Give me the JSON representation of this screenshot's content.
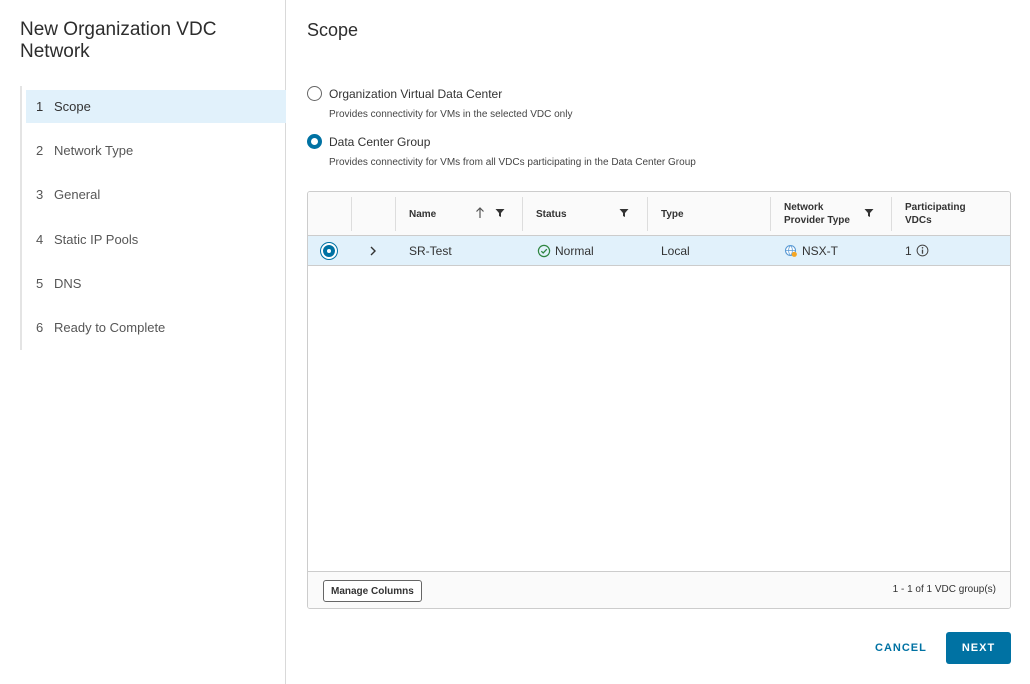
{
  "wizard": {
    "title": "New Organization VDC Network",
    "steps": [
      {
        "num": "1",
        "label": "Scope",
        "active": true
      },
      {
        "num": "2",
        "label": "Network Type"
      },
      {
        "num": "3",
        "label": "General"
      },
      {
        "num": "4",
        "label": "Static IP Pools"
      },
      {
        "num": "5",
        "label": "DNS"
      },
      {
        "num": "6",
        "label": "Ready to Complete"
      }
    ]
  },
  "main": {
    "title": "Scope",
    "options": [
      {
        "label": "Organization Virtual Data Center",
        "desc": "Provides connectivity for VMs in the selected VDC only",
        "selected": false
      },
      {
        "label": "Data Center Group",
        "desc": "Provides connectivity for VMs from all VDCs participating in the Data Center Group",
        "selected": true
      }
    ]
  },
  "grid": {
    "columns": {
      "name": "Name",
      "status": "Status",
      "type": "Type",
      "provider_line1": "Network",
      "provider_line2": "Provider Type",
      "participating_line1": "Participating",
      "participating_line2": "VDCs"
    },
    "rows": [
      {
        "name": "SR-Test",
        "status": "Normal",
        "type": "Local",
        "provider": "NSX-T",
        "participating": "1"
      }
    ],
    "manage_columns": "Manage Columns",
    "pagination": "1 - 1 of 1 VDC group(s)"
  },
  "buttons": {
    "cancel": "CANCEL",
    "next": "NEXT"
  },
  "colors": {
    "accent": "#0072a3",
    "selected_bg": "#e1f1fb",
    "status_ok": "#2e8540"
  }
}
